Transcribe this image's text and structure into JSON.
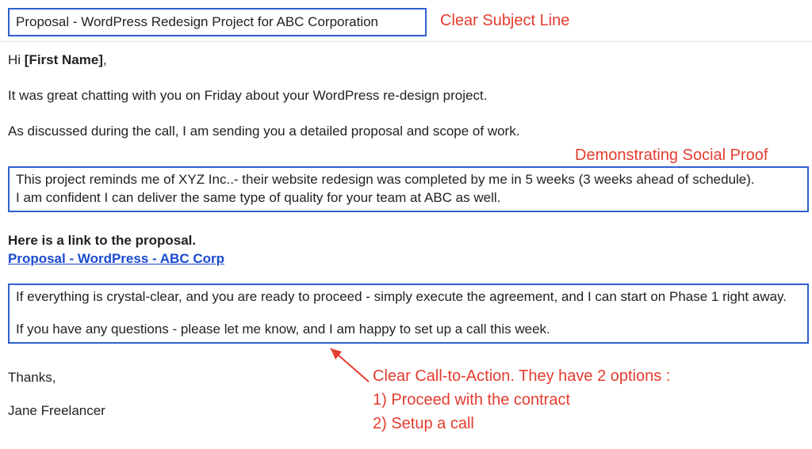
{
  "subject": "Proposal - WordPress Redesign Project for ABC Corporation",
  "greeting_prefix": "Hi ",
  "greeting_name": "[First Name]",
  "greeting_suffix": ",",
  "line1": "It was great chatting with you on Friday about your WordPress re-design project.",
  "line2": "As discussed during the call, I am sending you a detailed proposal and scope of work.",
  "social_proof_1": "This project reminds me of XYZ Inc..- their website redesign was completed by me in 5 weeks (3 weeks ahead of schedule).",
  "social_proof_2": "I am confident I can deliver the same type of quality for your team at ABC as well.",
  "proposal_intro": "Here is a link to the proposal.",
  "proposal_link": "Proposal - WordPress - ABC Corp",
  "cta_1": "If everything is crystal-clear, and you are ready to proceed - simply execute the agreement, and I can start on Phase 1 right away.",
  "cta_2": "If you have any questions - please let me know, and I am happy to set up a call this week.",
  "signoff": "Thanks,",
  "signature": "Jane Freelancer",
  "annot_subject": "Clear Subject Line",
  "annot_social": "Demonstrating Social Proof",
  "annot_cta_1": "Clear Call-to-Action. They have 2 options :",
  "annot_cta_2": "1) Proceed with the contract",
  "annot_cta_3": "2) Setup a call"
}
